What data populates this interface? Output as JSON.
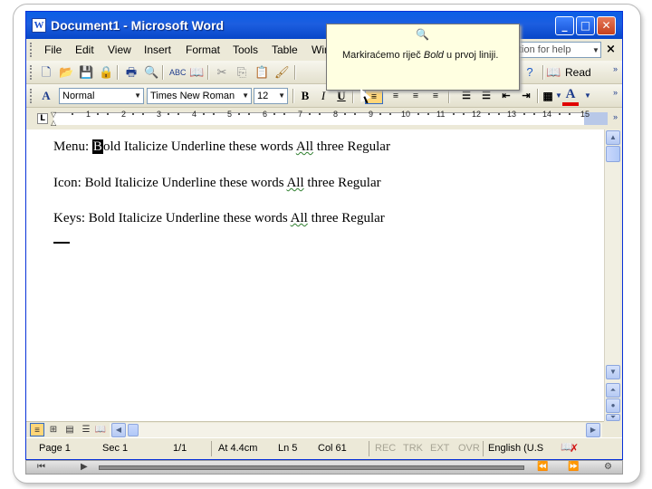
{
  "window": {
    "title": "Document1 - Microsoft Word",
    "app_icon": "W"
  },
  "menubar": {
    "items": [
      "File",
      "Edit",
      "View",
      "Insert",
      "Format",
      "Tools",
      "Table",
      "Win"
    ],
    "help_placeholder": "tion for help",
    "close": "×"
  },
  "toolbar": {
    "read_label": "Read"
  },
  "formatting": {
    "style": "Normal",
    "font": "Times New Roman",
    "size": "12",
    "bold": "B",
    "italic": "I",
    "underline": "U",
    "font_color": "#e00000"
  },
  "ruler": {
    "numbers": [
      "1",
      "2",
      "3",
      "4",
      "5",
      "6",
      "7",
      "8",
      "9",
      "10",
      "11",
      "12",
      "13",
      "14",
      "15"
    ]
  },
  "document": {
    "lines": [
      {
        "label": "Menu:",
        "word_first": "B",
        "word_rest": "old",
        "mid": "Italicize Underline these words",
        "all": "All",
        "end": "three Regular"
      },
      {
        "label": "Icon:",
        "word_first": "",
        "word_rest": "Bold",
        "mid": "Italicize Underline these words",
        "all": "All",
        "end": "three Regular"
      },
      {
        "label": "Keys:",
        "word_first": "",
        "word_rest": "Bold",
        "mid": "Italicize Underline these words",
        "all": "All",
        "end": "three Regular"
      }
    ]
  },
  "status": {
    "page": "Page 1",
    "sec": "Sec 1",
    "pages": "1/1",
    "at": "At 4.4cm",
    "ln": "Ln 5",
    "col": "Col 61",
    "rec": "REC",
    "trk": "TRK",
    "ext": "EXT",
    "ovr": "OVR",
    "language": "English (U.S"
  },
  "tooltip": {
    "text_before": "Markiraćemo riječ",
    "text_emph": "Bold",
    "text_after": "u prvoj liniji."
  }
}
